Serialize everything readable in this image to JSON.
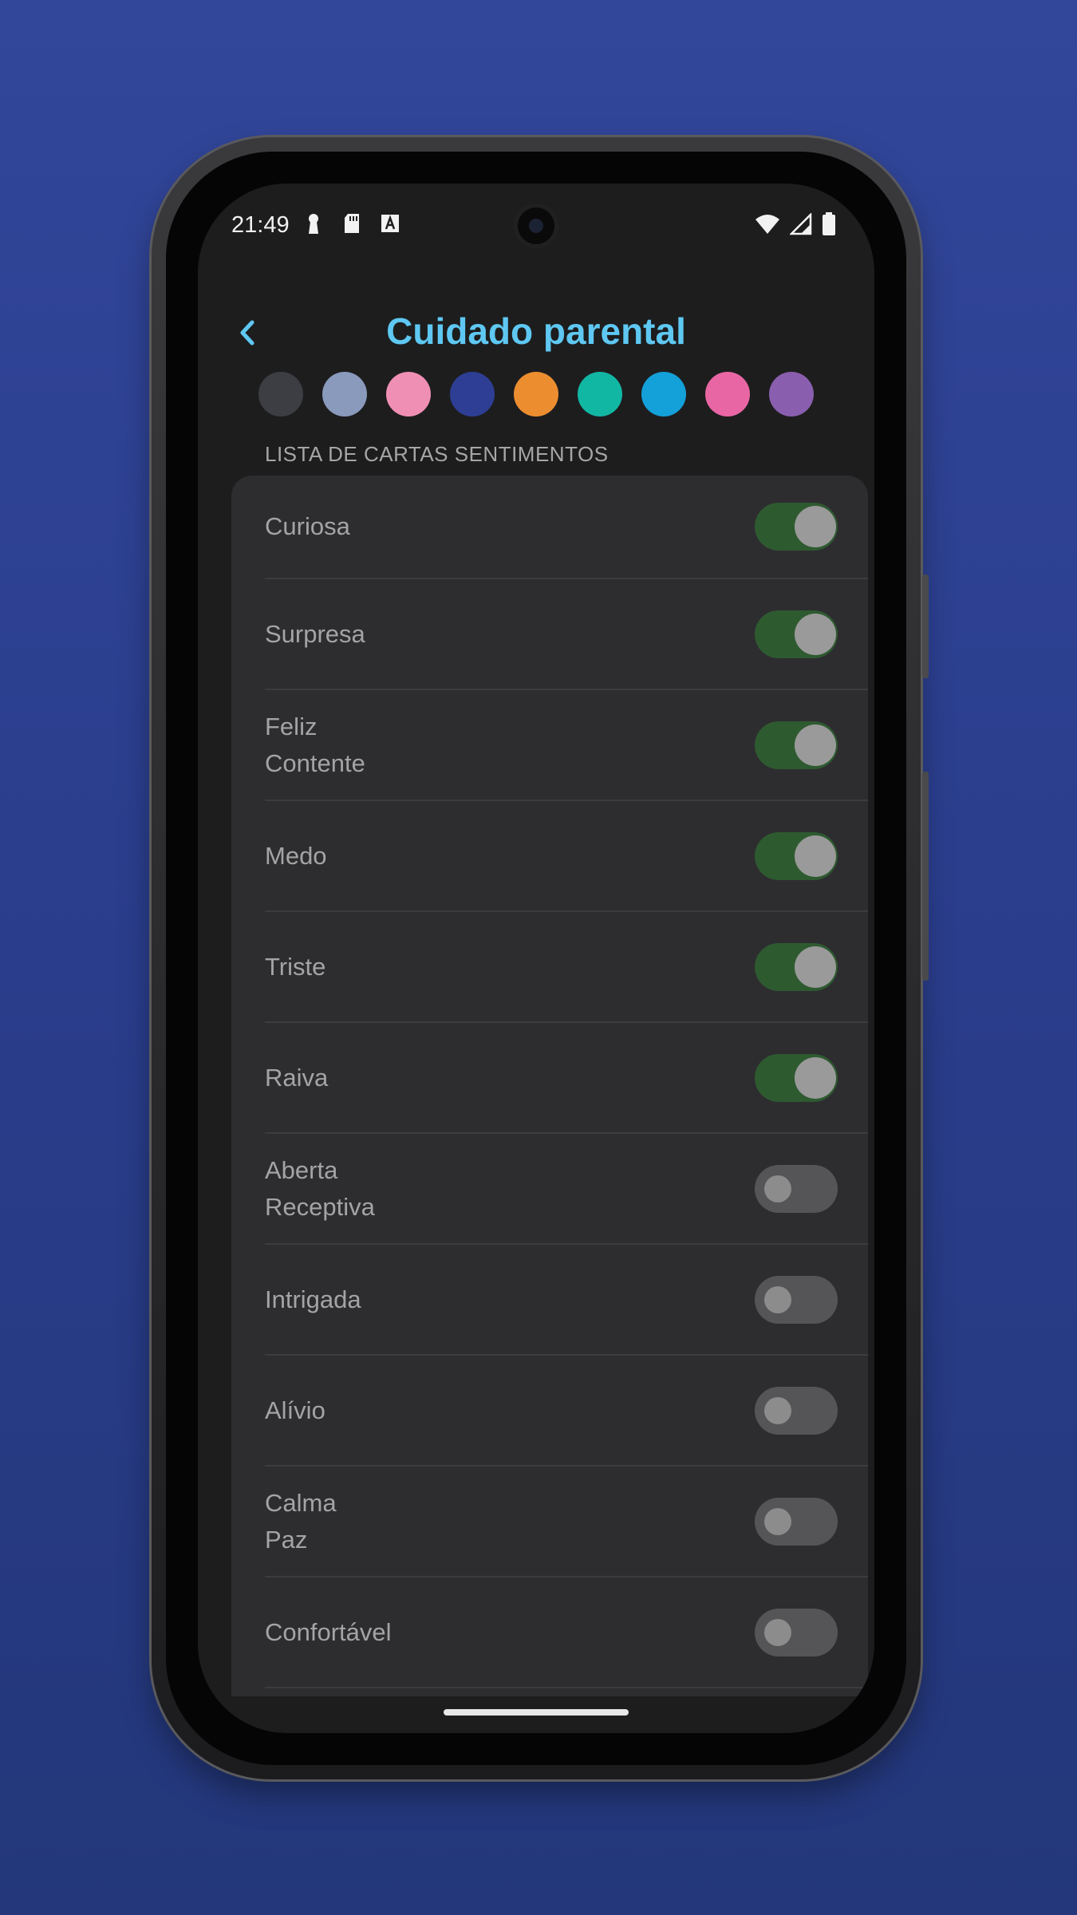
{
  "status_bar": {
    "time": "21:49",
    "left_icons": [
      "keyhole-icon",
      "sd-card-icon",
      "font-a-icon"
    ],
    "right_icons": [
      "wifi-icon",
      "signal-icon",
      "battery-icon"
    ]
  },
  "header": {
    "title": "Cuidado parental",
    "back_icon": "chevron-left-icon"
  },
  "colors": {
    "title": "#5ec8f2",
    "toggle_on": "#2e5a30",
    "toggle_off": "#555557",
    "palette": [
      "#3d3e44",
      "#8a9abc",
      "#f08fb4",
      "#2e3e94",
      "#ec8e30",
      "#12b7a4",
      "#14a0d8",
      "#e966a4",
      "#8a5eae"
    ]
  },
  "section": {
    "label": "LISTA DE CARTAS SENTIMENTOS"
  },
  "feelings": [
    {
      "label": "Curiosa",
      "enabled": true
    },
    {
      "label": "Surpresa",
      "enabled": true
    },
    {
      "label": "Feliz\nContente",
      "enabled": true
    },
    {
      "label": "Medo",
      "enabled": true
    },
    {
      "label": "Triste",
      "enabled": true
    },
    {
      "label": "Raiva",
      "enabled": true
    },
    {
      "label": "Aberta\nReceptiva",
      "enabled": false
    },
    {
      "label": "Intrigada",
      "enabled": false
    },
    {
      "label": "Alívio",
      "enabled": false
    },
    {
      "label": "Calma\nPaz",
      "enabled": false
    },
    {
      "label": "Confortável",
      "enabled": false
    },
    {
      "label": "",
      "enabled": null
    }
  ]
}
